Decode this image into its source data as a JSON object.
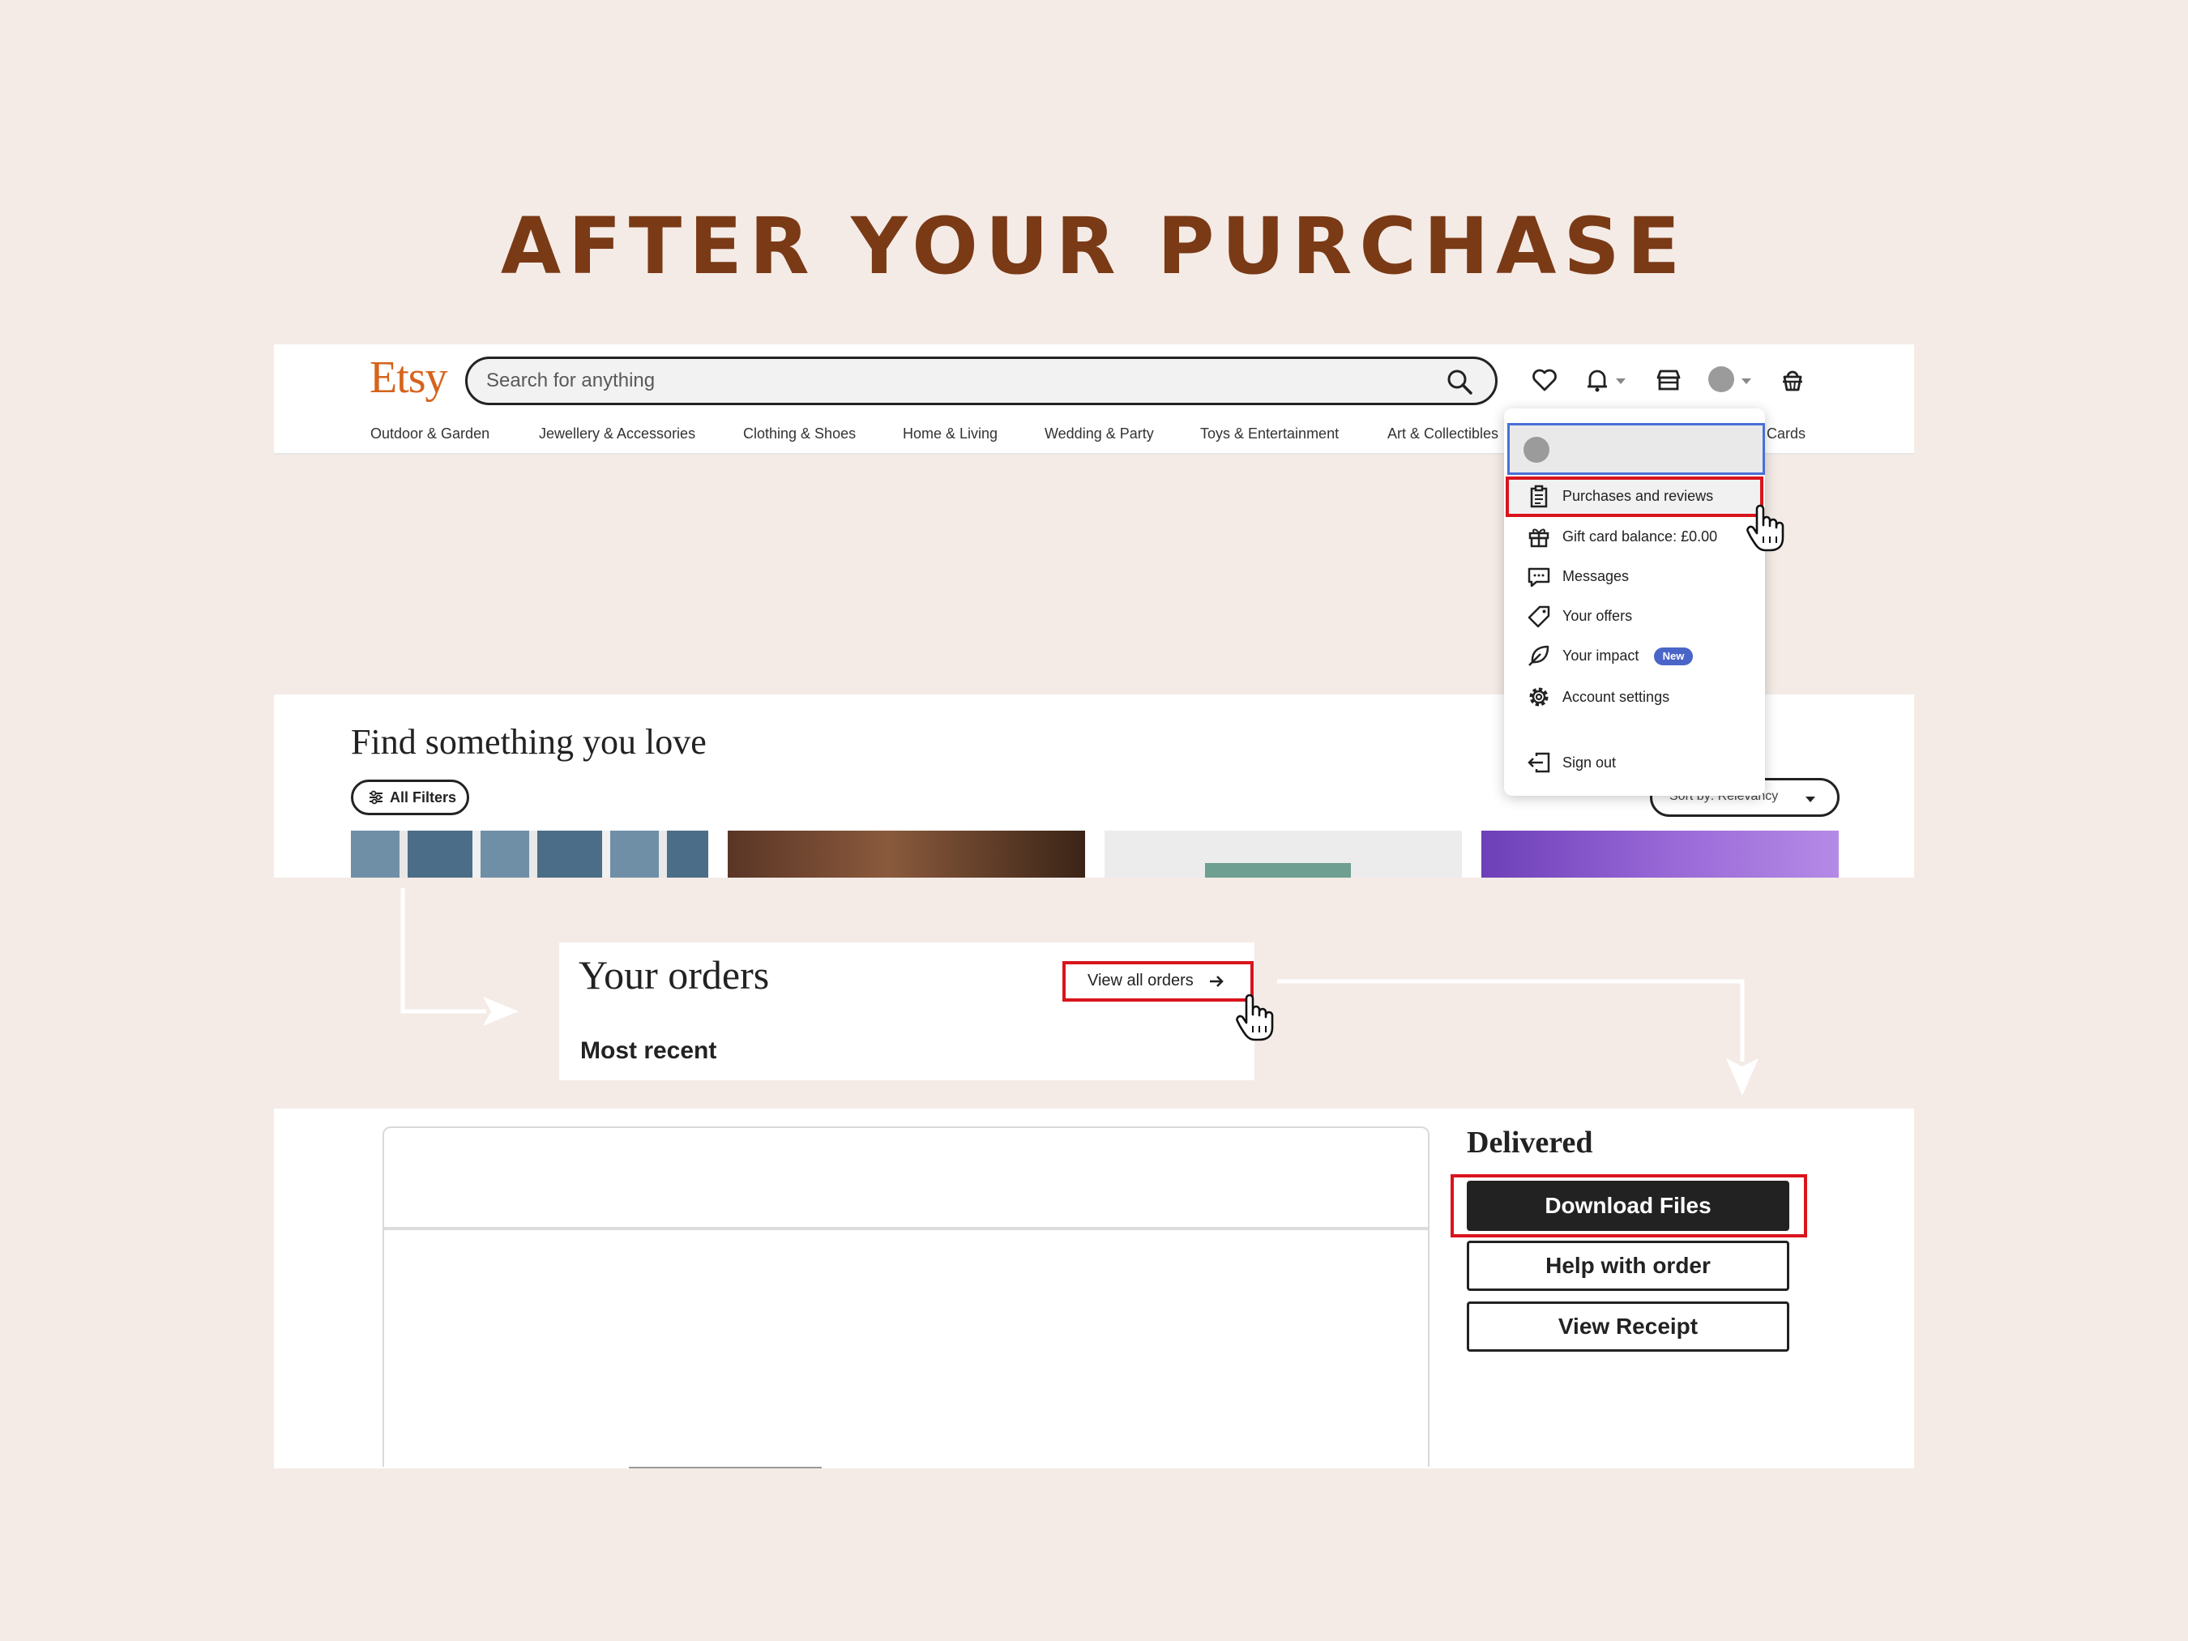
{
  "heading": "AFTER YOUR PURCHASE",
  "header": {
    "logo": "Etsy",
    "search_placeholder": "Search for anything",
    "categories": [
      "Outdoor & Garden",
      "Jewellery & Accessories",
      "Clothing & Shoes",
      "Home & Living",
      "Wedding & Party",
      "Toys & Entertainment",
      "Art & Collectibles",
      "Cards"
    ]
  },
  "account_menu": {
    "items": [
      {
        "label": "Purchases and reviews",
        "icon": "clipboard-icon"
      },
      {
        "label": "Gift card balance: £0.00",
        "icon": "gift-icon"
      },
      {
        "label": "Messages",
        "icon": "messages-icon"
      },
      {
        "label": "Your offers",
        "icon": "tag-icon"
      },
      {
        "label": "Your impact",
        "icon": "leaf-icon"
      },
      {
        "label": "Account settings",
        "icon": "gear-icon"
      },
      {
        "label": "Sign out",
        "icon": "sign-out-icon"
      }
    ],
    "new_badge": "New"
  },
  "find": {
    "title": "Find something you love",
    "filters_label": "All Filters",
    "sort_label": "Sort by: Relevancy"
  },
  "orders": {
    "title": "Your orders",
    "view_all": "View all orders",
    "subtitle": "Most recent"
  },
  "order_detail": {
    "status": "Delivered",
    "download": "Download Files",
    "help": "Help with order",
    "receipt": "View Receipt"
  },
  "colors": {
    "background": "#f4ebe6",
    "heading": "#7a3a16",
    "etsy_orange": "#d5641c",
    "highlight_red": "#d9141c",
    "badge_blue": "#4a65c8"
  }
}
